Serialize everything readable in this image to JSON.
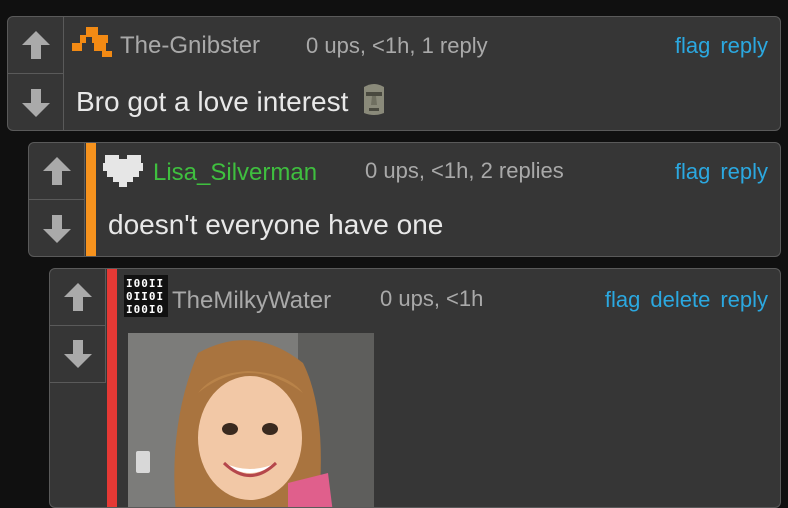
{
  "comments": [
    {
      "username": "The-Gnibster",
      "meta": "0 ups, <1h, 1 reply",
      "actions": [
        "flag",
        "reply"
      ],
      "body": "Bro got a love interest",
      "body_emoji": "moai-emoji",
      "username_color": "#a9a9a9",
      "avatar_icon": "orange-pixel-icon"
    },
    {
      "username": "Lisa_Silverman",
      "meta": "0 ups, <1h, 2 replies",
      "actions": [
        "flag",
        "reply"
      ],
      "body": "doesn't everyone have one",
      "username_color": "#3fbf3f",
      "stripe_color": "#f7931e",
      "avatar_icon": "pixel-heart-icon"
    },
    {
      "username": "TheMilkyWater",
      "meta": "0 ups, <1h",
      "actions": [
        "flag",
        "delete",
        "reply"
      ],
      "username_color": "#a9a9a9",
      "stripe_color": "#e53935",
      "avatar_icon": "binary-avatar-icon",
      "avatar_text": [
        "I00II",
        "0II0I",
        "I00I0"
      ],
      "attachment": "smiling-girl-photo"
    }
  ],
  "colors": {
    "link": "#2ba8e0",
    "panel": "#363636",
    "border": "#5a5a5a"
  }
}
